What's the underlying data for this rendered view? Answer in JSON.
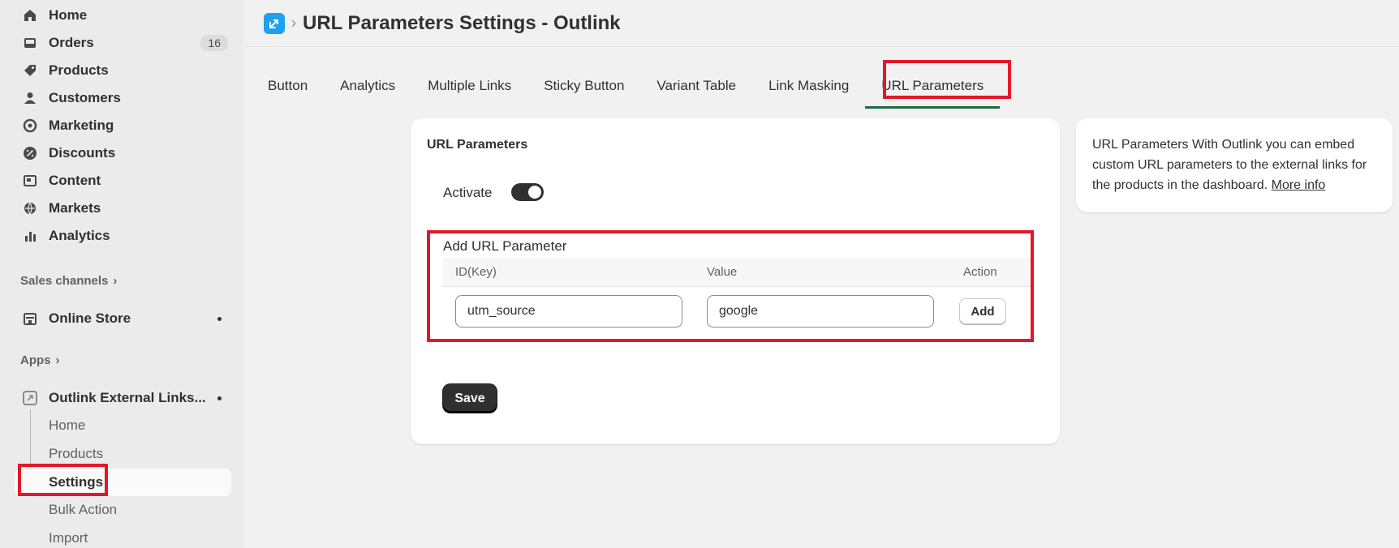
{
  "sidebar": {
    "nav": [
      {
        "label": "Home",
        "icon": "home-icon"
      },
      {
        "label": "Orders",
        "icon": "orders-icon",
        "badge": "16"
      },
      {
        "label": "Products",
        "icon": "tag-icon"
      },
      {
        "label": "Customers",
        "icon": "person-icon"
      },
      {
        "label": "Marketing",
        "icon": "marketing-icon"
      },
      {
        "label": "Discounts",
        "icon": "discount-icon"
      },
      {
        "label": "Content",
        "icon": "content-icon"
      },
      {
        "label": "Markets",
        "icon": "globe-icon"
      },
      {
        "label": "Analytics",
        "icon": "bar-chart-icon"
      }
    ],
    "sales_channels_label": "Sales channels",
    "online_store_label": "Online Store",
    "apps_label": "Apps",
    "app_name": "Outlink External Links...",
    "app_sub_items": [
      "Home",
      "Products",
      "Settings",
      "Bulk Action",
      "Import"
    ]
  },
  "header": {
    "title": "URL Parameters Settings - Outlink",
    "separator": "›"
  },
  "tabs": [
    "Button",
    "Analytics",
    "Multiple Links",
    "Sticky Button",
    "Variant Table",
    "Link Masking",
    "URL Parameters"
  ],
  "active_tab": "URL Parameters",
  "card": {
    "title": "URL Parameters",
    "activate_label": "Activate",
    "activate_on": true,
    "add_param_title": "Add URL Parameter",
    "columns": [
      "ID(Key)",
      "Value",
      "Action"
    ],
    "key_value": "utm_source",
    "value_value": "google",
    "add_label": "Add",
    "save_label": "Save"
  },
  "info": {
    "text": "URL Parameters With Outlink you can embed custom URL parameters to the external links for the products in the dashboard.",
    "link": "More info"
  },
  "colors": {
    "highlight": "#e0192a",
    "active_tab_underline": "#1a6b43",
    "app_icon": "#1da1f2"
  }
}
